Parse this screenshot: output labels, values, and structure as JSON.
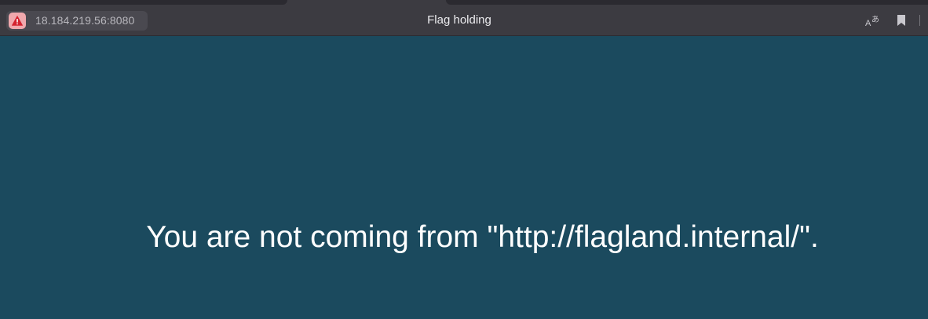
{
  "browser": {
    "address": "18.184.219.56:8080",
    "tab_title": "Flag holding",
    "security_status": "not-secure",
    "security_icon": "warning-triangle-icon",
    "toolbar_icons": [
      "translate-icon",
      "bookmark-icon"
    ]
  },
  "page": {
    "message": "You are not coming from \"http://flagland.internal/\".",
    "background_color": "#1b4a5e",
    "text_color": "#ffffff"
  },
  "colors": {
    "toolbar": "#3c3b41",
    "warning_badge": "#f0a8ad",
    "warning_icon": "#d4222f"
  }
}
